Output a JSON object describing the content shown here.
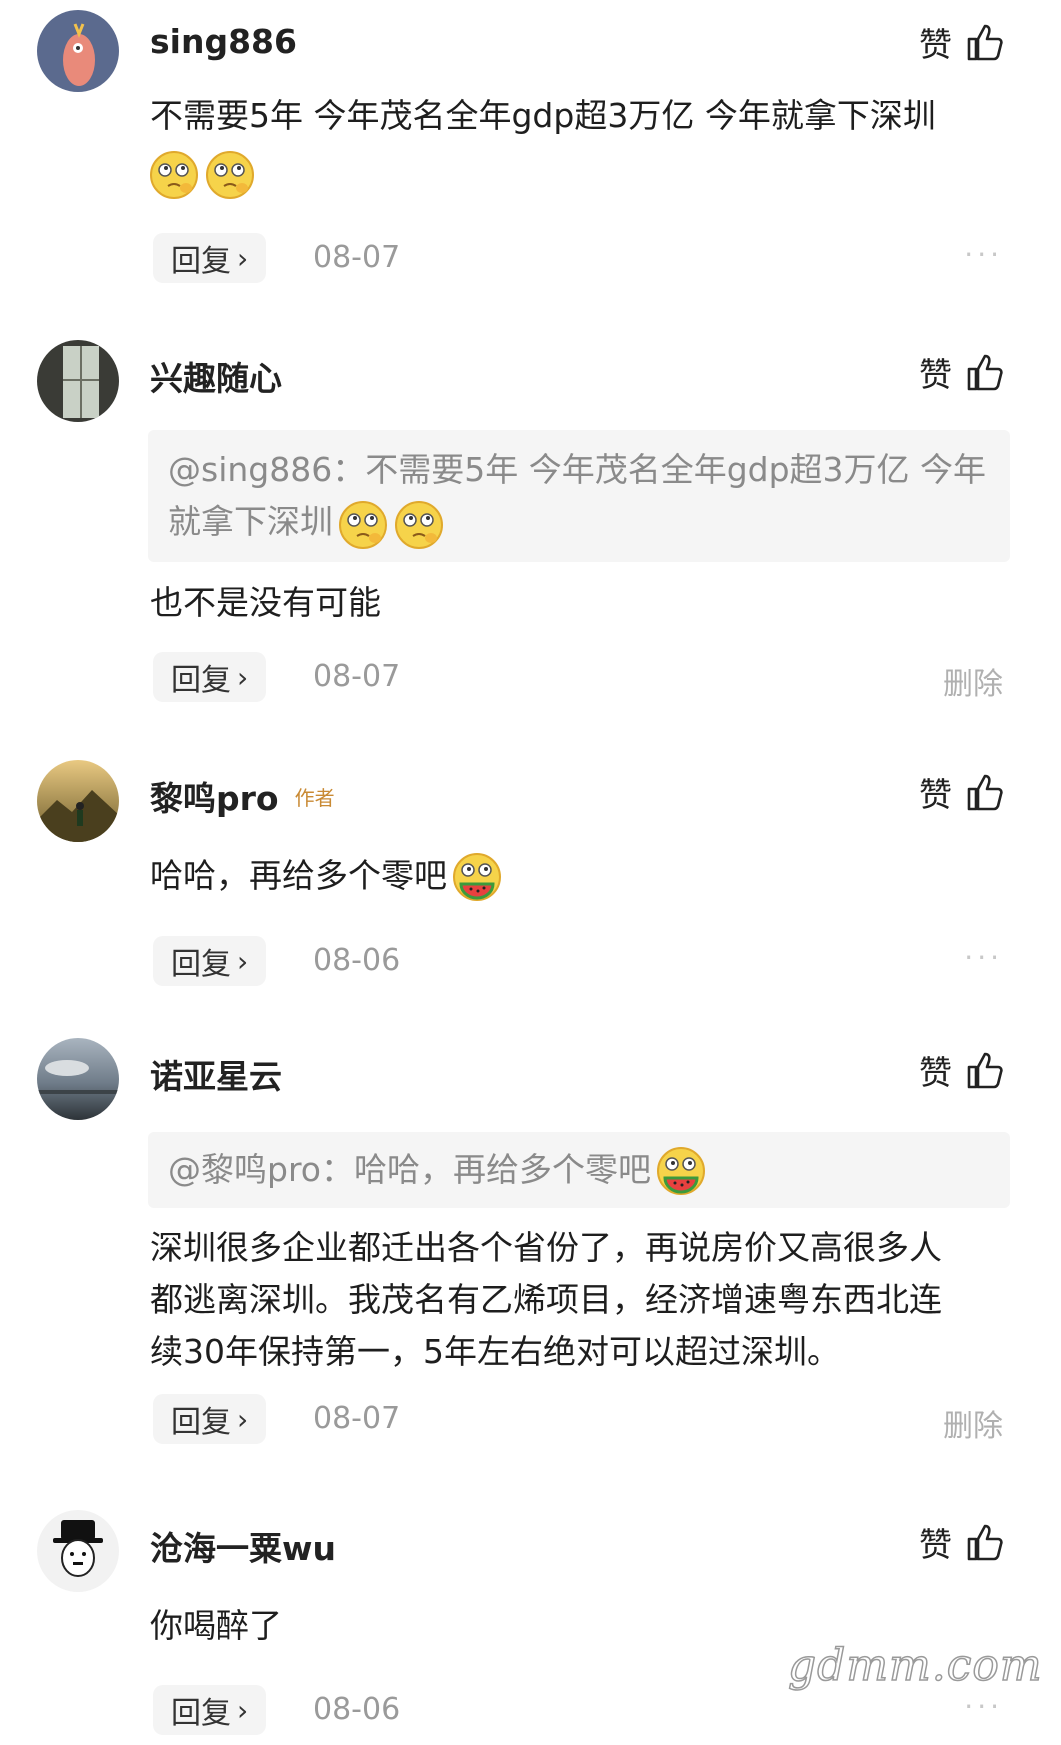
{
  "like_label": "赞",
  "reply_label": "回复",
  "reply_chevron": "›",
  "delete_label": "删除",
  "more_label": "···",
  "watermark": "gdmm.com",
  "comments": [
    {
      "username": "sing886",
      "avatar_icon": "bird-avatar-icon",
      "text": "不需要5年 今年茂名全年gdp超3万亿 今年就拿下深圳",
      "emojis": [
        "thinking-emoji",
        "thinking-emoji"
      ],
      "date": "08-07",
      "action": "more"
    },
    {
      "username": "兴趣随心",
      "avatar_icon": "window-avatar-icon",
      "quote": "@sing886：不需要5年 今年茂名全年gdp超3万亿 今年就拿下深圳",
      "text": "也不是没有可能",
      "date": "08-07",
      "action": "delete"
    },
    {
      "username": "黎鸣pro",
      "badge": "作者",
      "avatar_icon": "mountain-avatar-icon",
      "text": "哈哈，再给多个零吧",
      "date": "08-06",
      "action": "more"
    },
    {
      "username": "诺亚星云",
      "avatar_icon": "seascape-avatar-icon",
      "quote": "@黎鸣pro：哈哈，再给多个零吧",
      "text_lines": [
        "深圳很多企业都迁出各个省份了，再说房价又高很多人",
        "都逃离深圳。我茂名有乙烯项目，经济增速粤东西北连",
        "续30年保持第一，5年左右绝对可以超过深圳。"
      ],
      "date": "08-07",
      "action": "delete"
    },
    {
      "username": "沧海一粟wu",
      "avatar_icon": "chaplin-avatar-icon",
      "text": "你喝醉了",
      "date": "08-06",
      "action": "more"
    }
  ]
}
